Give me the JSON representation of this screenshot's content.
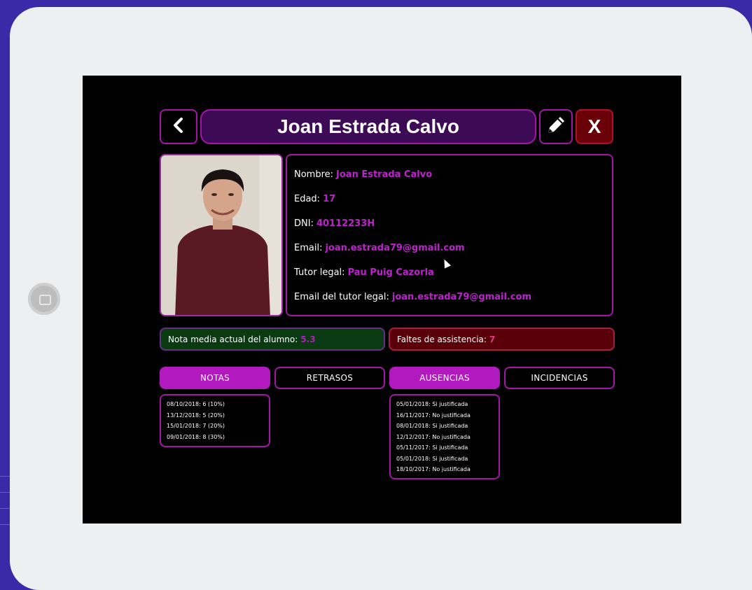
{
  "header": {
    "back_symbol": "<",
    "title": "Joan Estrada Calvo",
    "close_symbol": "X",
    "edit_icon": "pencil-icon"
  },
  "profile": {
    "photo": "student-photo",
    "fields": [
      {
        "label": "Nombre:",
        "value": "Joan Estrada Calvo"
      },
      {
        "label": "Edad:",
        "value": "17"
      },
      {
        "label": "DNI:",
        "value": "40112233H"
      },
      {
        "label": "Email:",
        "value": "joan.estrada79@gmail.com"
      },
      {
        "label": "Tutor legal:",
        "value": "Pau Puig Cazorla"
      },
      {
        "label": "Email del tutor legal:",
        "value": "joan.estrada79@gmail.com"
      }
    ]
  },
  "summary": {
    "grade_label": "Nota media actual del alumno:",
    "grade_value": "5.3",
    "absences_label": "Faltes de assistencia:",
    "absences_value": "7"
  },
  "tabs": [
    {
      "label": "NOTAS",
      "active": true
    },
    {
      "label": "RETRASOS",
      "active": false
    },
    {
      "label": "AUSENCIAS",
      "active": true
    },
    {
      "label": "INCIDENCIAS",
      "active": false
    }
  ],
  "notas_list": [
    "08/10/2018: 6 (10%)",
    "13/12/2018: 5 (20%)",
    "15/01/2018: 7 (20%)",
    "09/01/2018: 8 (30%)"
  ],
  "ausencias_list": [
    "05/01/2018: Si justificada",
    "16/11/2017: No justificada",
    "08/01/2018: Si justificada",
    "12/12/2017: No justificada",
    "05/11/2017: Si justificada",
    "05/01/2018: Si justificada",
    "18/10/2017: No justificada"
  ],
  "colors": {
    "accent": "#b21ac0",
    "title_bg": "#3d0a55",
    "close_bg": "#6a0008",
    "grade_bg": "#0a3a12",
    "absence_bg": "#5a0008",
    "page_bg": "#3a2aa8"
  }
}
